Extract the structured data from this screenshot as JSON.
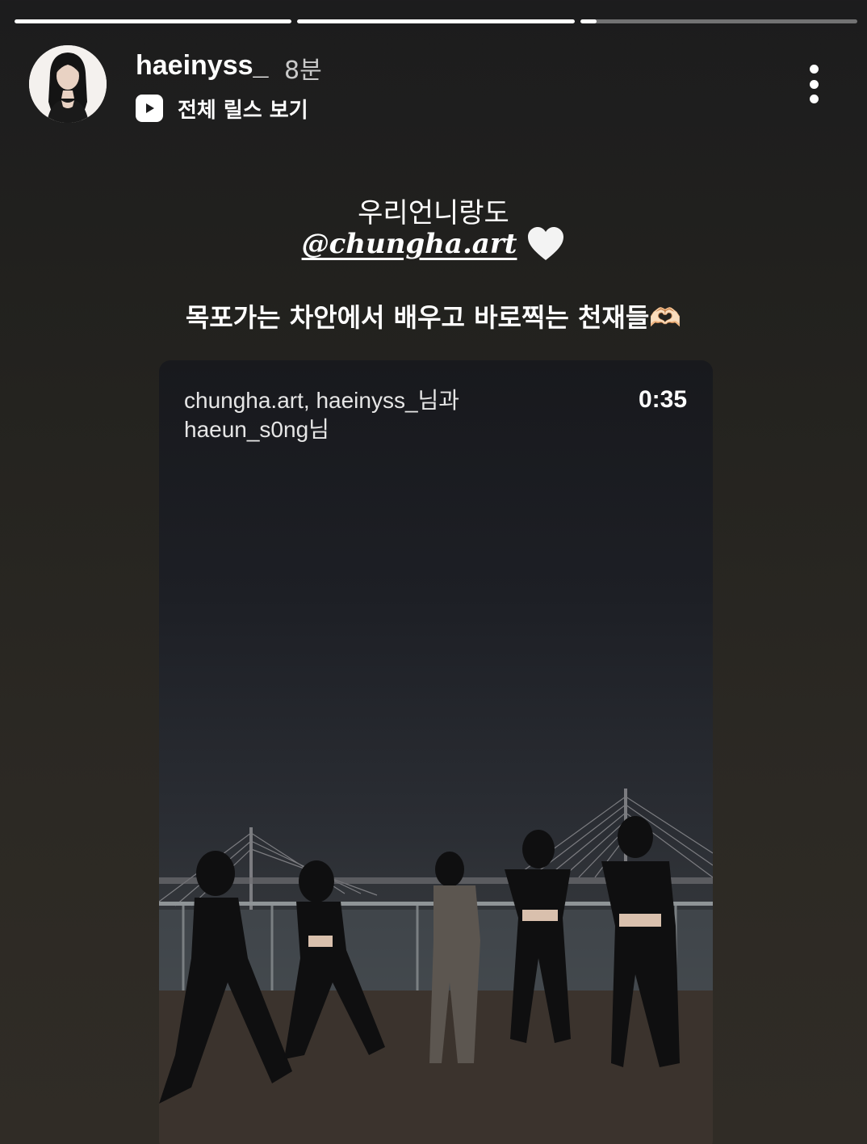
{
  "story": {
    "progress": [
      1.0,
      1.0,
      0.06
    ]
  },
  "header": {
    "username": "haeinyss_",
    "time_ago": "8분",
    "reels_link_label": "전체 릴스 보기"
  },
  "caption": {
    "line1": "우리언니랑도",
    "mention": "@chungha.art",
    "line3": "목포가는 차안에서 배우고 바로찍는 천재들🫶🏻"
  },
  "video": {
    "credits_line1": "chungha.art, haeinyss_님과",
    "credits_line2": "haeun_s0ng님",
    "duration": "0:35"
  },
  "icons": {
    "play": "play-icon",
    "more": "more-options-icon",
    "heart": "white-heart-icon"
  }
}
